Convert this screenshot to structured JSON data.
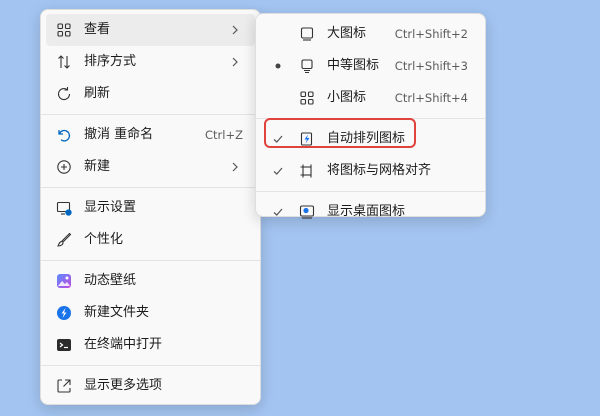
{
  "main_menu": {
    "view": {
      "label": "查看",
      "icon": "grid-icon"
    },
    "sort": {
      "label": "排序方式",
      "icon": "sort-icon"
    },
    "refresh": {
      "label": "刷新",
      "icon": "refresh-icon"
    },
    "undo": {
      "label": "撤消 重命名",
      "shortcut": "Ctrl+Z",
      "icon": "undo-icon"
    },
    "new": {
      "label": "新建",
      "icon": "plus-circle-icon"
    },
    "display_settings": {
      "label": "显示设置",
      "icon": "display-settings-icon"
    },
    "personalize": {
      "label": "个性化",
      "icon": "brush-icon"
    },
    "dynamic_wallpaper": {
      "label": "动态壁纸",
      "icon": "wallpaper-icon"
    },
    "new_folder": {
      "label": "新建文件夹",
      "icon": "new-folder-icon"
    },
    "open_terminal": {
      "label": "在终端中打开",
      "icon": "terminal-icon"
    },
    "more_options": {
      "label": "显示更多选项",
      "icon": "more-options-icon"
    }
  },
  "view_submenu": {
    "large_icons": {
      "label": "大图标",
      "shortcut": "Ctrl+Shift+2",
      "icon": "large-icon-icon"
    },
    "medium_icons": {
      "label": "中等图标",
      "shortcut": "Ctrl+Shift+3",
      "icon": "monitor-icon",
      "selected": true
    },
    "small_icons": {
      "label": "小图标",
      "shortcut": "Ctrl+Shift+4",
      "icon": "small-grid-icon"
    },
    "auto_arrange": {
      "label": "自动排列图标",
      "icon": "auto-arrange-icon",
      "checked": true
    },
    "align_grid": {
      "label": "将图标与网格对齐",
      "icon": "align-grid-icon",
      "checked": true
    },
    "show_desktop_icons": {
      "label": "显示桌面图标",
      "icon": "desktop-icons-icon",
      "checked": true
    }
  },
  "colors": {
    "desktop": "#a3c4f1",
    "menu_bg": "#f9f9f9",
    "hover": "#ececec",
    "highlight_border": "#e0433b",
    "accent": "#0067c0"
  }
}
